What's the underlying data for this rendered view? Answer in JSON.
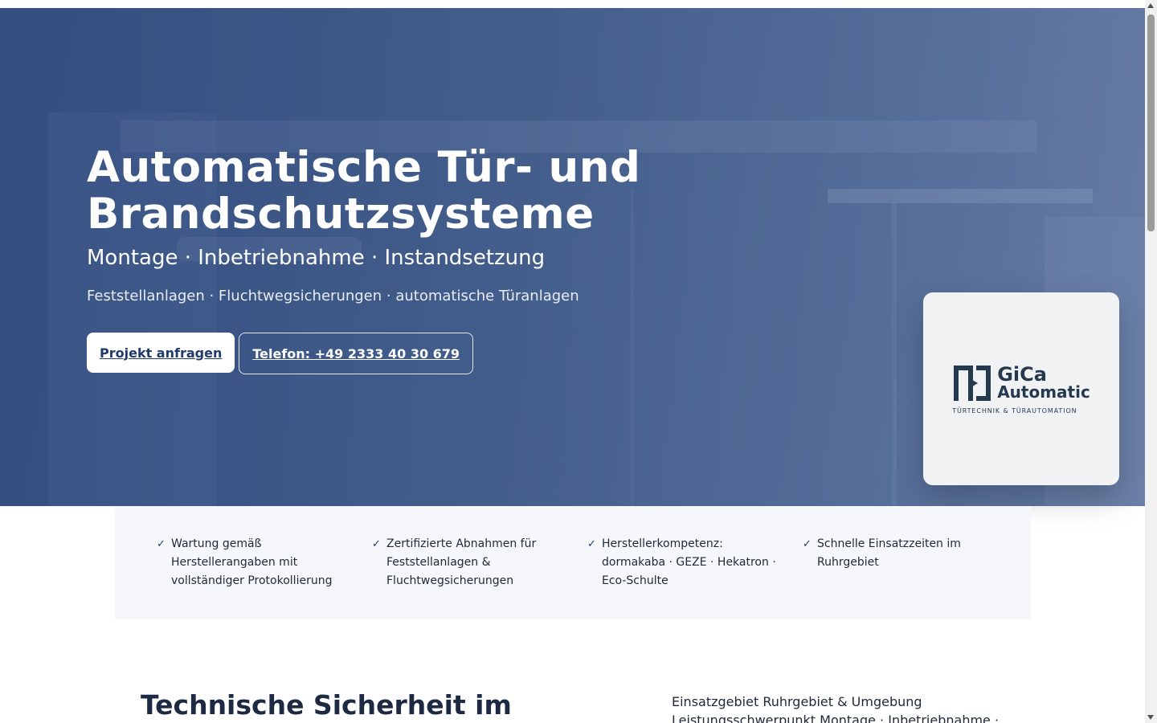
{
  "hero": {
    "title_line1": "Automatische Tür- und",
    "title_line2": "Brandschutzsysteme",
    "subtitle": "Montage · Inbetriebnahme · Instandsetzung",
    "tagline": "Feststellanlagen · Fluchtwegsicherungen · automatische Türanlagen",
    "primary_button": "Projekt anfragen",
    "phone_button": "Telefon: +49 2333 40 30 679"
  },
  "logo": {
    "name_line1": "GiCa",
    "name_line2": "Automatic",
    "tagline": "TÜRTECHNIK & TÜRAUTOMATION"
  },
  "features": [
    {
      "icon": "check-icon",
      "text": "Wartung gemäß Herstellerangaben mit vollständiger Protokollierung"
    },
    {
      "icon": "check-icon",
      "text": "Zertifizierte Abnahmen für Feststellanlagen & Fluchtwegsicherungen"
    },
    {
      "icon": "check-icon",
      "text": "Herstellerkompetenz: dormakaba · GEZE · Hekatron · Eco-Schulte"
    },
    {
      "icon": "check-icon",
      "text": "Schnelle Einsatzzeiten im Ruhrgebiet"
    }
  ],
  "section": {
    "title": "Technische Sicherheit im",
    "info_line1": "Einsatzgebiet Ruhrgebiet & Umgebung",
    "info_line2": "Leistungsschwerpunkt Montage · Inbetriebnahme ·"
  },
  "colors": {
    "hero_blue": "#3a5484",
    "brand_dark": "#263a4f",
    "button_text": "#1f3a6b",
    "features_bg": "#f5f7fb"
  }
}
